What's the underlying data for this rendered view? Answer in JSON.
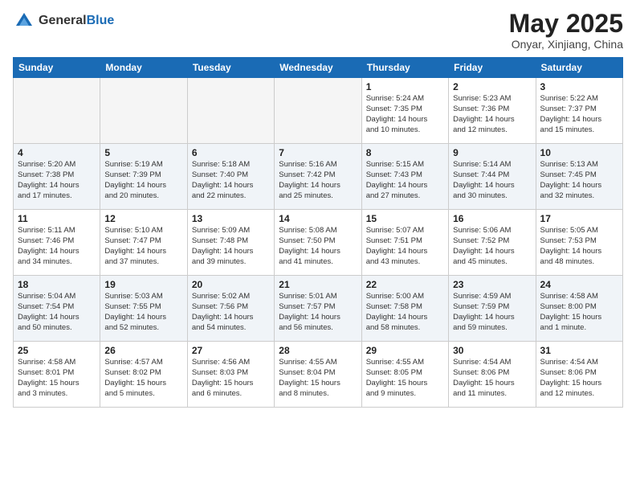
{
  "header": {
    "logo_general": "General",
    "logo_blue": "Blue",
    "month_title": "May 2025",
    "location": "Onyar, Xinjiang, China"
  },
  "days_of_week": [
    "Sunday",
    "Monday",
    "Tuesday",
    "Wednesday",
    "Thursday",
    "Friday",
    "Saturday"
  ],
  "weeks": [
    [
      {
        "day": "",
        "info": ""
      },
      {
        "day": "",
        "info": ""
      },
      {
        "day": "",
        "info": ""
      },
      {
        "day": "",
        "info": ""
      },
      {
        "day": "1",
        "info": "Sunrise: 5:24 AM\nSunset: 7:35 PM\nDaylight: 14 hours\nand 10 minutes."
      },
      {
        "day": "2",
        "info": "Sunrise: 5:23 AM\nSunset: 7:36 PM\nDaylight: 14 hours\nand 12 minutes."
      },
      {
        "day": "3",
        "info": "Sunrise: 5:22 AM\nSunset: 7:37 PM\nDaylight: 14 hours\nand 15 minutes."
      }
    ],
    [
      {
        "day": "4",
        "info": "Sunrise: 5:20 AM\nSunset: 7:38 PM\nDaylight: 14 hours\nand 17 minutes."
      },
      {
        "day": "5",
        "info": "Sunrise: 5:19 AM\nSunset: 7:39 PM\nDaylight: 14 hours\nand 20 minutes."
      },
      {
        "day": "6",
        "info": "Sunrise: 5:18 AM\nSunset: 7:40 PM\nDaylight: 14 hours\nand 22 minutes."
      },
      {
        "day": "7",
        "info": "Sunrise: 5:16 AM\nSunset: 7:42 PM\nDaylight: 14 hours\nand 25 minutes."
      },
      {
        "day": "8",
        "info": "Sunrise: 5:15 AM\nSunset: 7:43 PM\nDaylight: 14 hours\nand 27 minutes."
      },
      {
        "day": "9",
        "info": "Sunrise: 5:14 AM\nSunset: 7:44 PM\nDaylight: 14 hours\nand 30 minutes."
      },
      {
        "day": "10",
        "info": "Sunrise: 5:13 AM\nSunset: 7:45 PM\nDaylight: 14 hours\nand 32 minutes."
      }
    ],
    [
      {
        "day": "11",
        "info": "Sunrise: 5:11 AM\nSunset: 7:46 PM\nDaylight: 14 hours\nand 34 minutes."
      },
      {
        "day": "12",
        "info": "Sunrise: 5:10 AM\nSunset: 7:47 PM\nDaylight: 14 hours\nand 37 minutes."
      },
      {
        "day": "13",
        "info": "Sunrise: 5:09 AM\nSunset: 7:48 PM\nDaylight: 14 hours\nand 39 minutes."
      },
      {
        "day": "14",
        "info": "Sunrise: 5:08 AM\nSunset: 7:50 PM\nDaylight: 14 hours\nand 41 minutes."
      },
      {
        "day": "15",
        "info": "Sunrise: 5:07 AM\nSunset: 7:51 PM\nDaylight: 14 hours\nand 43 minutes."
      },
      {
        "day": "16",
        "info": "Sunrise: 5:06 AM\nSunset: 7:52 PM\nDaylight: 14 hours\nand 45 minutes."
      },
      {
        "day": "17",
        "info": "Sunrise: 5:05 AM\nSunset: 7:53 PM\nDaylight: 14 hours\nand 48 minutes."
      }
    ],
    [
      {
        "day": "18",
        "info": "Sunrise: 5:04 AM\nSunset: 7:54 PM\nDaylight: 14 hours\nand 50 minutes."
      },
      {
        "day": "19",
        "info": "Sunrise: 5:03 AM\nSunset: 7:55 PM\nDaylight: 14 hours\nand 52 minutes."
      },
      {
        "day": "20",
        "info": "Sunrise: 5:02 AM\nSunset: 7:56 PM\nDaylight: 14 hours\nand 54 minutes."
      },
      {
        "day": "21",
        "info": "Sunrise: 5:01 AM\nSunset: 7:57 PM\nDaylight: 14 hours\nand 56 minutes."
      },
      {
        "day": "22",
        "info": "Sunrise: 5:00 AM\nSunset: 7:58 PM\nDaylight: 14 hours\nand 58 minutes."
      },
      {
        "day": "23",
        "info": "Sunrise: 4:59 AM\nSunset: 7:59 PM\nDaylight: 14 hours\nand 59 minutes."
      },
      {
        "day": "24",
        "info": "Sunrise: 4:58 AM\nSunset: 8:00 PM\nDaylight: 15 hours\nand 1 minute."
      }
    ],
    [
      {
        "day": "25",
        "info": "Sunrise: 4:58 AM\nSunset: 8:01 PM\nDaylight: 15 hours\nand 3 minutes."
      },
      {
        "day": "26",
        "info": "Sunrise: 4:57 AM\nSunset: 8:02 PM\nDaylight: 15 hours\nand 5 minutes."
      },
      {
        "day": "27",
        "info": "Sunrise: 4:56 AM\nSunset: 8:03 PM\nDaylight: 15 hours\nand 6 minutes."
      },
      {
        "day": "28",
        "info": "Sunrise: 4:55 AM\nSunset: 8:04 PM\nDaylight: 15 hours\nand 8 minutes."
      },
      {
        "day": "29",
        "info": "Sunrise: 4:55 AM\nSunset: 8:05 PM\nDaylight: 15 hours\nand 9 minutes."
      },
      {
        "day": "30",
        "info": "Sunrise: 4:54 AM\nSunset: 8:06 PM\nDaylight: 15 hours\nand 11 minutes."
      },
      {
        "day": "31",
        "info": "Sunrise: 4:54 AM\nSunset: 8:06 PM\nDaylight: 15 hours\nand 12 minutes."
      }
    ]
  ]
}
